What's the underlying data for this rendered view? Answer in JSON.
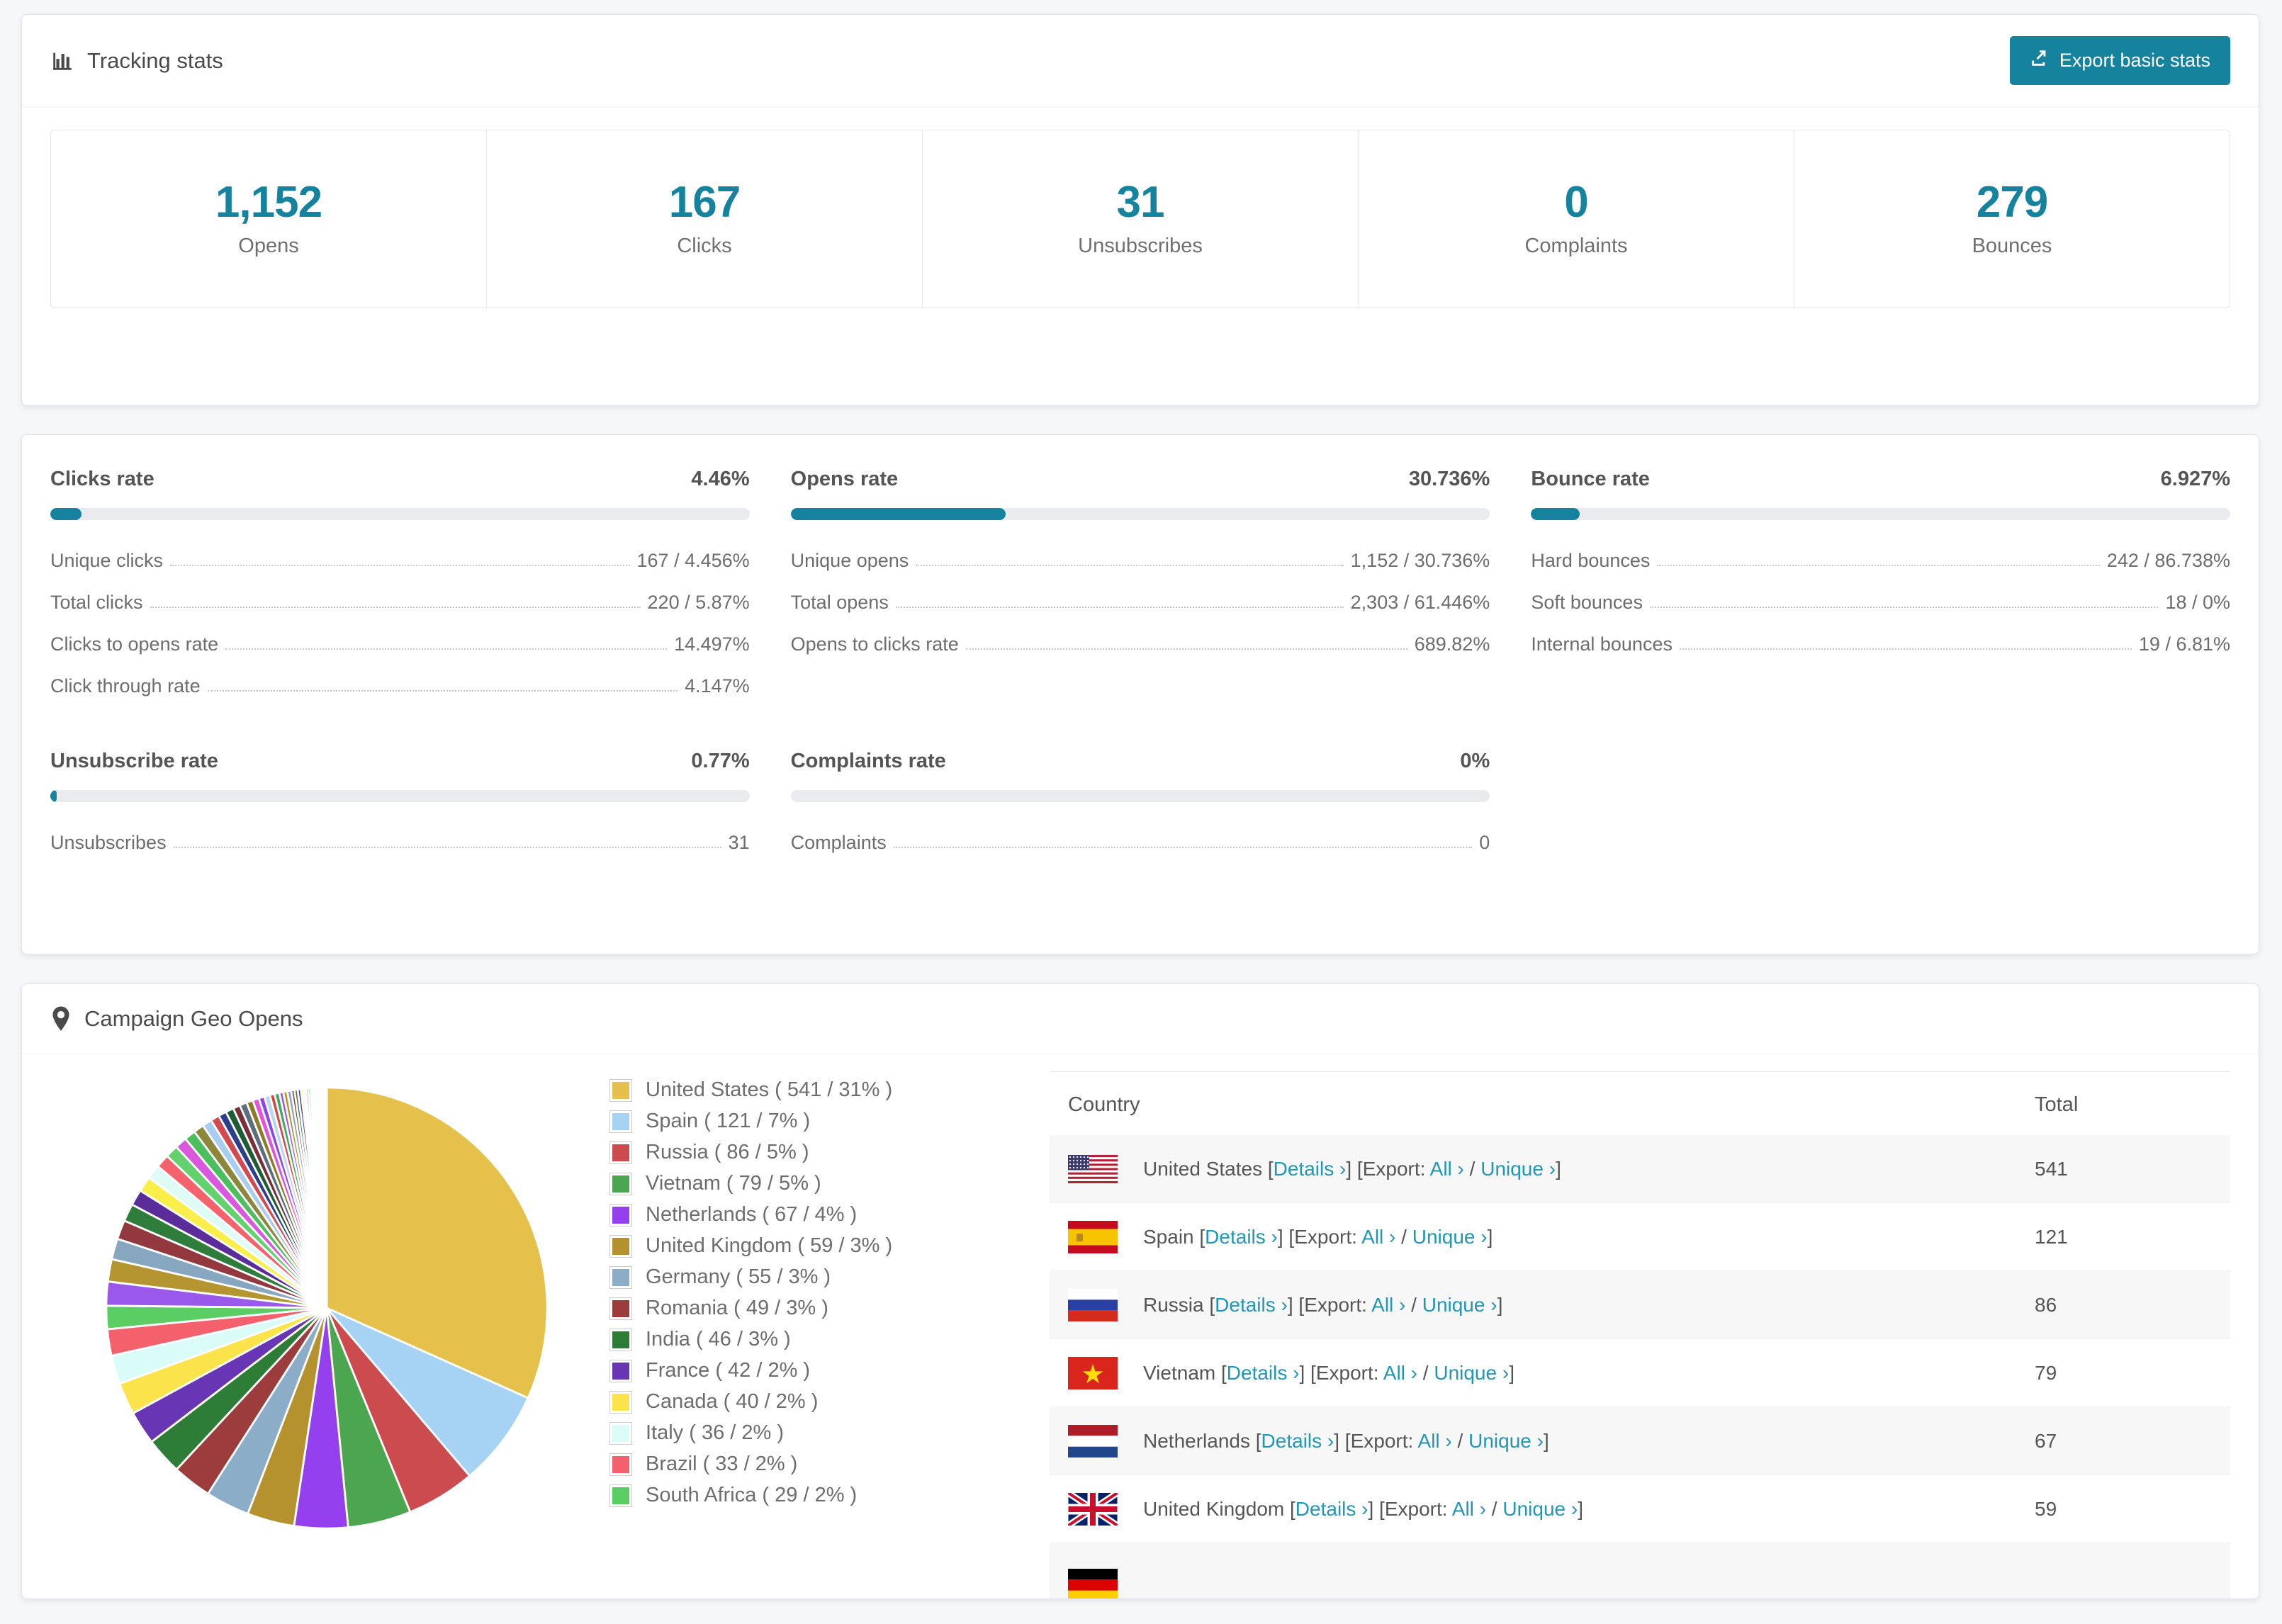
{
  "accent_color": "#15829e",
  "link_color": "#2196b5",
  "tracking": {
    "title": "Tracking stats",
    "export_button": "Export basic stats",
    "stats": [
      {
        "value": "1,152",
        "label": "Opens"
      },
      {
        "value": "167",
        "label": "Clicks"
      },
      {
        "value": "31",
        "label": "Unsubscribes"
      },
      {
        "value": "0",
        "label": "Complaints"
      },
      {
        "value": "279",
        "label": "Bounces"
      }
    ]
  },
  "rates": {
    "row1": [
      {
        "title": "Clicks rate",
        "value": "4.46%",
        "percent": 4.46,
        "rows": [
          [
            "Unique clicks",
            "167 / 4.456%"
          ],
          [
            "Total clicks",
            "220 / 5.87%"
          ],
          [
            "Clicks to opens rate",
            "14.497%"
          ],
          [
            "Click through rate",
            "4.147%"
          ]
        ]
      },
      {
        "title": "Opens rate",
        "value": "30.736%",
        "percent": 30.736,
        "rows": [
          [
            "Unique opens",
            "1,152 / 30.736%"
          ],
          [
            "Total opens",
            "2,303 / 61.446%"
          ],
          [
            "Opens to clicks rate",
            "689.82%"
          ]
        ]
      },
      {
        "title": "Bounce rate",
        "value": "6.927%",
        "percent": 6.927,
        "rows": [
          [
            "Hard bounces",
            "242 / 86.738%"
          ],
          [
            "Soft bounces",
            "18 / 0%"
          ],
          [
            "Internal bounces",
            "19 / 6.81%"
          ]
        ]
      }
    ],
    "row2": [
      {
        "title": "Unsubscribe rate",
        "value": "0.77%",
        "percent": 0.77,
        "rows": [
          [
            "Unsubscribes",
            "31"
          ]
        ]
      },
      {
        "title": "Complaints rate",
        "value": "0%",
        "percent": 0,
        "rows": [
          [
            "Complaints",
            "0"
          ]
        ]
      }
    ]
  },
  "geo": {
    "title": "Campaign Geo Opens",
    "chart_data": {
      "type": "pie",
      "title": "Campaign Geo Opens",
      "legend_position": "right",
      "slices": [
        {
          "label": "United States",
          "value": 541,
          "pct": "31%",
          "color": "#e5c14c"
        },
        {
          "label": "Spain",
          "value": 121,
          "pct": "7%",
          "color": "#a6d3f3"
        },
        {
          "label": "Russia",
          "value": 86,
          "pct": "5%",
          "color": "#cc4b4f"
        },
        {
          "label": "Vietnam",
          "value": 79,
          "pct": "5%",
          "color": "#4ba64f"
        },
        {
          "label": "Netherlands",
          "value": 67,
          "pct": "4%",
          "color": "#9540ef"
        },
        {
          "label": "United Kingdom",
          "value": 59,
          "pct": "3%",
          "color": "#b6922f"
        },
        {
          "label": "Germany",
          "value": 55,
          "pct": "3%",
          "color": "#8badc7"
        },
        {
          "label": "Romania",
          "value": 49,
          "pct": "3%",
          "color": "#9d3c3c"
        },
        {
          "label": "India",
          "value": 46,
          "pct": "3%",
          "color": "#2e7d36"
        },
        {
          "label": "France",
          "value": 42,
          "pct": "2%",
          "color": "#6836b4"
        },
        {
          "label": "Canada",
          "value": 40,
          "pct": "2%",
          "color": "#fbe44b"
        },
        {
          "label": "Italy",
          "value": 36,
          "pct": "2%",
          "color": "#d9fcf8"
        },
        {
          "label": "Brazil",
          "value": 33,
          "pct": "2%",
          "color": "#f4606b"
        },
        {
          "label": "South Africa",
          "value": 29,
          "pct": "2%",
          "color": "#5ace62"
        }
      ],
      "unlabeled_small_slices": [
        30,
        28,
        26,
        24,
        22,
        20,
        19,
        18,
        17,
        16,
        15,
        14,
        13,
        12,
        11,
        10,
        10,
        9,
        9,
        8,
        8,
        7,
        7,
        6,
        6,
        5,
        5,
        5,
        4,
        4,
        4,
        3,
        3,
        3,
        3,
        2,
        2,
        2,
        2,
        2,
        1,
        1,
        1,
        1,
        1,
        1,
        1,
        1,
        1,
        1
      ],
      "small_slice_palette": [
        "#9b59ec",
        "#b5952f",
        "#87a7c0",
        "#93383f",
        "#2e7d3b",
        "#5b2d9b",
        "#f9ee4a",
        "#dffbf6",
        "#f4626b",
        "#63d16d",
        "#d958de",
        "#4bbf5e",
        "#8c873a",
        "#a9cdf0",
        "#d2494f",
        "#2c3e8c",
        "#1d5d34",
        "#7a2f36",
        "#5d6f7e",
        "#8a7d26",
        "#e255d8",
        "#8e44ec",
        "#b7d6f2",
        "#d64545",
        "#43a557"
      ]
    },
    "legend_format": {
      "open": "(",
      "sep": "/",
      "close": ")"
    },
    "table": {
      "columns": [
        "Country",
        "Total"
      ],
      "links": {
        "details": "Details ›",
        "export_prefix": "Export:",
        "all": "All ›",
        "unique": "Unique ›",
        "bracket_open": "[",
        "bracket_close": "]",
        "slash": "/"
      },
      "rows": [
        {
          "country": "United States",
          "flag": "us",
          "total": "541"
        },
        {
          "country": "Spain",
          "flag": "es",
          "total": "121"
        },
        {
          "country": "Russia",
          "flag": "ru",
          "total": "86"
        },
        {
          "country": "Vietnam",
          "flag": "vn",
          "total": "79"
        },
        {
          "country": "Netherlands",
          "flag": "nl",
          "total": "67"
        },
        {
          "country": "United Kingdom",
          "flag": "gb",
          "total": "59"
        },
        {
          "country": "",
          "flag": "de",
          "total": "",
          "partial": true
        }
      ]
    }
  }
}
